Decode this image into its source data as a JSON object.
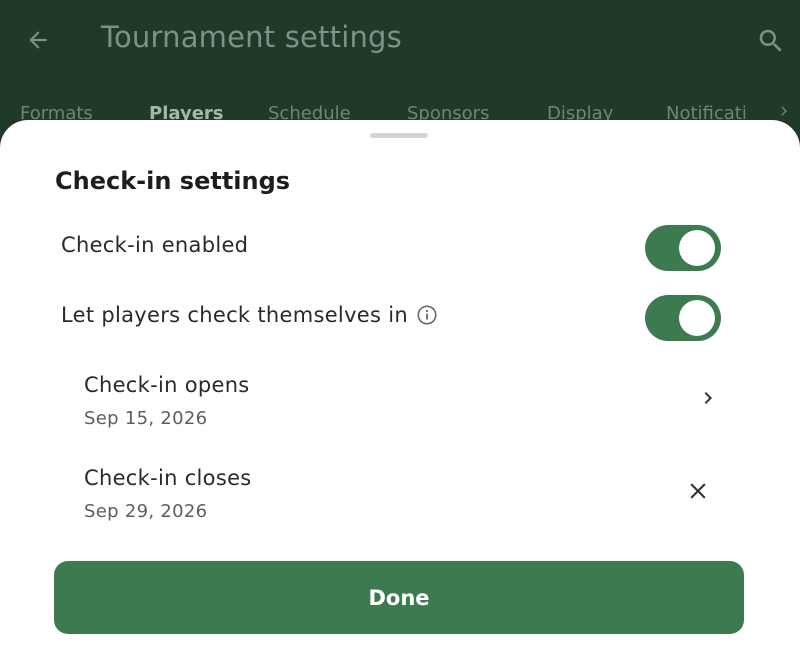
{
  "appbar": {
    "title": "Tournament settings",
    "back_icon": "arrow-back-icon",
    "search_icon": "search-icon"
  },
  "tabs": [
    {
      "label": "Formats",
      "active": false
    },
    {
      "label": "Players",
      "active": true
    },
    {
      "label": "Schedule",
      "active": false
    },
    {
      "label": "Sponsors",
      "active": false
    },
    {
      "label": "Display",
      "active": false
    },
    {
      "label": "Notificati",
      "active": false
    }
  ],
  "sheet": {
    "title": "Check-in settings",
    "checkin_enabled": {
      "label": "Check-in enabled",
      "on": true
    },
    "self_checkin": {
      "label": "Let players check themselves in",
      "on": true,
      "icon": "info-icon"
    },
    "opens": {
      "title": "Check-in opens",
      "value": "Sep 15, 2026",
      "action_icon": "chevron-right-icon"
    },
    "closes": {
      "title": "Check-in closes",
      "value": "Sep 29, 2026",
      "action_icon": "close-icon"
    },
    "done_label": "Done"
  },
  "colors": {
    "appbar_bg": "#1f3a29",
    "accent": "#3d7a50",
    "sheet_bg": "#ffffff"
  }
}
